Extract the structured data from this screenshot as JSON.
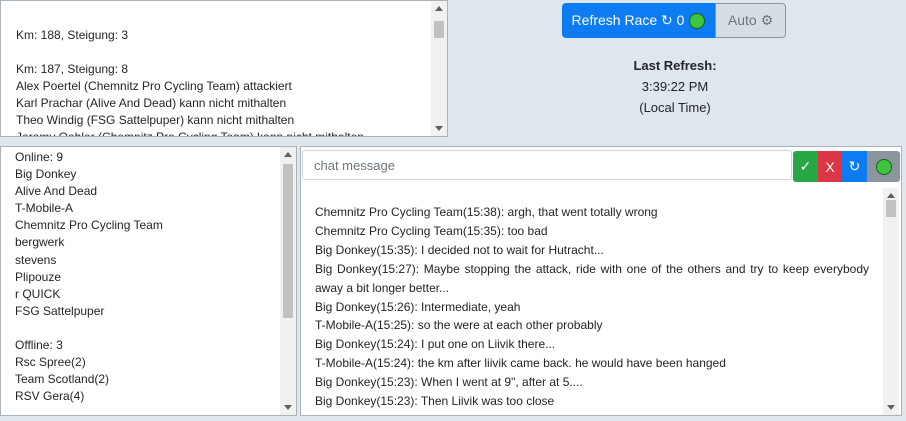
{
  "race_log": {
    "lines": [
      "",
      "Km: 188, Steigung: 3",
      "",
      "Km: 187, Steigung: 8",
      "Alex Poertel (Chemnitz Pro Cycling Team) attackiert",
      "Karl Prachar (Alive And Dead) kann nicht mithalten",
      "Theo Windig (FSG Sattelpuper) kann nicht mithalten",
      "Jeremy Oehler (Chemnitz Pro Cycling Team) kann nicht mithalten"
    ]
  },
  "controls": {
    "refresh_label": "Refresh Race ↻ 0",
    "auto_label": "Auto ⚙",
    "last_refresh_label": "Last Refresh:",
    "last_refresh_time": "3:39:22 PM",
    "last_refresh_zone": "(Local Time)"
  },
  "teams": {
    "lines": [
      "Online: 9",
      "Big Donkey",
      "Alive And Dead",
      "T-Mobile-A",
      "Chemnitz Pro Cycling Team",
      "bergwerk",
      "stevens",
      "Plipouze",
      "r QUICK",
      "FSG Sattelpuper",
      "",
      "Offline: 3",
      "Rsc Spree(2)",
      "Team Scotland(2)",
      "RSV Gera(4)"
    ]
  },
  "chat": {
    "placeholder": "chat message",
    "send_label": "✓",
    "clear_label": "X",
    "reload_label": "↻",
    "messages": [
      "Chemnitz Pro Cycling Team(15:38): argh, that went totally wrong",
      "Chemnitz Pro Cycling Team(15:35): too bad",
      "Big Donkey(15:35): I decided not to wait for Hutracht...",
      "Big Donkey(15:27): Maybe stopping the attack, ride with one of the others and try to keep everybody away a bit longer better...",
      "Big Donkey(15:26): Intermediate, yeah",
      "T-Mobile-A(15:25): so the were at each other probably",
      "Big Donkey(15:24): I put one on Liivik there...",
      "T-Mobile-A(15:24): the km after liivik came back. he would have been hanged",
      "Big Donkey(15:23): When I went at 9\", after at 5....",
      "Big Donkey(15:23): Then Liivik was too close"
    ]
  },
  "colors": {
    "primary": "#0d7cf2",
    "success": "#28a745",
    "danger": "#dc3545",
    "status_online": "#3ec43e",
    "background": "#dfe6ee"
  }
}
